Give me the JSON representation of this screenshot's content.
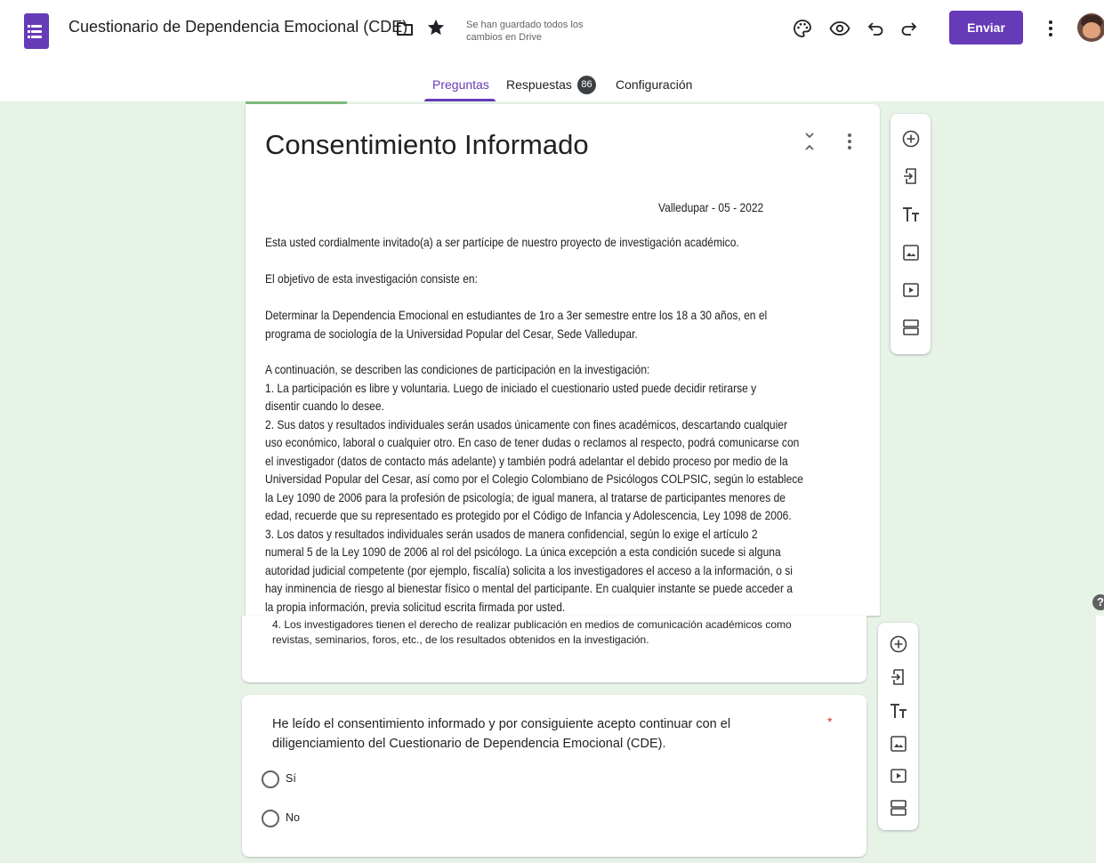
{
  "header": {
    "app_icon": "forms-icon",
    "title": "Cuestionario de Dependencia Emocional (CDE)",
    "save_status": "Se han guardado todos los cambios en Drive",
    "icons": [
      "folder-icon",
      "star-icon",
      "palette-icon",
      "eye-icon",
      "undo-icon",
      "redo-icon",
      "more-vert-icon",
      "avatar"
    ],
    "send_label": "Enviar",
    "accent": "#673ab7"
  },
  "tabs": {
    "preguntas": "Preguntas",
    "respuestas": "Respuestas",
    "respuestas_count": "86",
    "configuracion": "Configuración"
  },
  "section": {
    "title": "Consentimiento Informado",
    "date": "Valledupar - 05 -  2022",
    "intro": "Esta usted cordialmente invitado(a) a ser partícipe de nuestro proyecto de investigación académico.",
    "objective_label": "El objetivo de esta investigación consiste en:",
    "objective_line1": "Determinar la Dependencia Emocional en estudiantes de 1ro a 3er semestre entre los 18 a 30 años, en el",
    "objective_line2": "programa de sociología de la Universidad Popular del Cesar, Sede Valledupar.",
    "conditions": [
      "A continuación, se describen las condiciones de participación en la investigación:",
      "1.    La participación es libre y voluntaria. Luego de iniciado el cuestionario usted puede decidir retirarse y",
      "disentir cuando lo desee.",
      "2.    Sus datos y resultados individuales serán usados únicamente con fines académicos, descartando cualquier",
      "uso económico, laboral o cualquier otro. En caso de tener dudas o reclamos al respecto, podrá comunicarse con",
      "el investigador (datos de contacto más adelante) y también podrá adelantar el debido proceso por medio de la",
      "Universidad Popular del Cesar, así como por el Colegio Colombiano de Psicólogos COLPSIC, según lo establece",
      "la Ley 1090 de 2006 para la profesión de psicología; de igual manera, al tratarse de participantes menores de",
      "edad, recuerde que su representado es protegido por el Código de Infancia y Adolescencia, Ley 1098 de 2006.",
      "3.    Los datos y resultados individuales serán usados de manera confidencial, según lo exige el artículo 2",
      "numeral 5 de la Ley 1090 de 2006 al rol del psicólogo. La única excepción a esta condición sucede si alguna",
      "autoridad judicial competente (por ejemplo, fiscalía) solicita a los investigadores el acceso a la información, o si",
      "hay inminencia de riesgo al bienestar físico o mental del participante. En cualquier instante se puede acceder a",
      "la propia información, previa solicitud escrita firmada por usted."
    ],
    "condition4_line1": "4.    Los investigadores tienen el derecho de realizar publicación en medios de comunicación académicos como",
    "condition4_line2": "revistas, seminarios, foros, etc., de los resultados obtenidos en la investigación."
  },
  "question": {
    "text": "He leído el consentimiento informado y por consiguiente acepto continuar con el diligenciamiento del Cuestionario de Dependencia Emocional (CDE).",
    "required_mark": "*",
    "options": [
      "Sí",
      "No"
    ]
  },
  "toolbar": {
    "tools": [
      "add-question-icon",
      "import-questions-icon",
      "add-title-icon",
      "add-image-icon",
      "add-video-icon",
      "add-section-icon"
    ]
  },
  "help": "?"
}
